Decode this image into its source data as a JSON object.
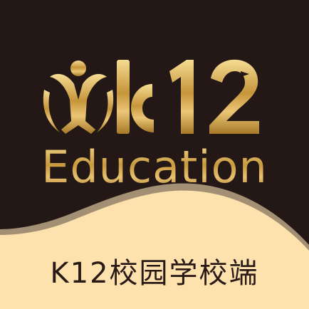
{
  "brand": {
    "logo_mark": "K12",
    "tagline": "Education"
  },
  "app": {
    "name": "K12校园学校端"
  },
  "colors": {
    "dark_panel": "#231815",
    "light_panel": "#fde2ae",
    "gold": "#d4a64e",
    "text_dark": "#2a1a17"
  },
  "icons": {
    "mascot": "person-figure-icon",
    "bird": "bird-icon"
  }
}
